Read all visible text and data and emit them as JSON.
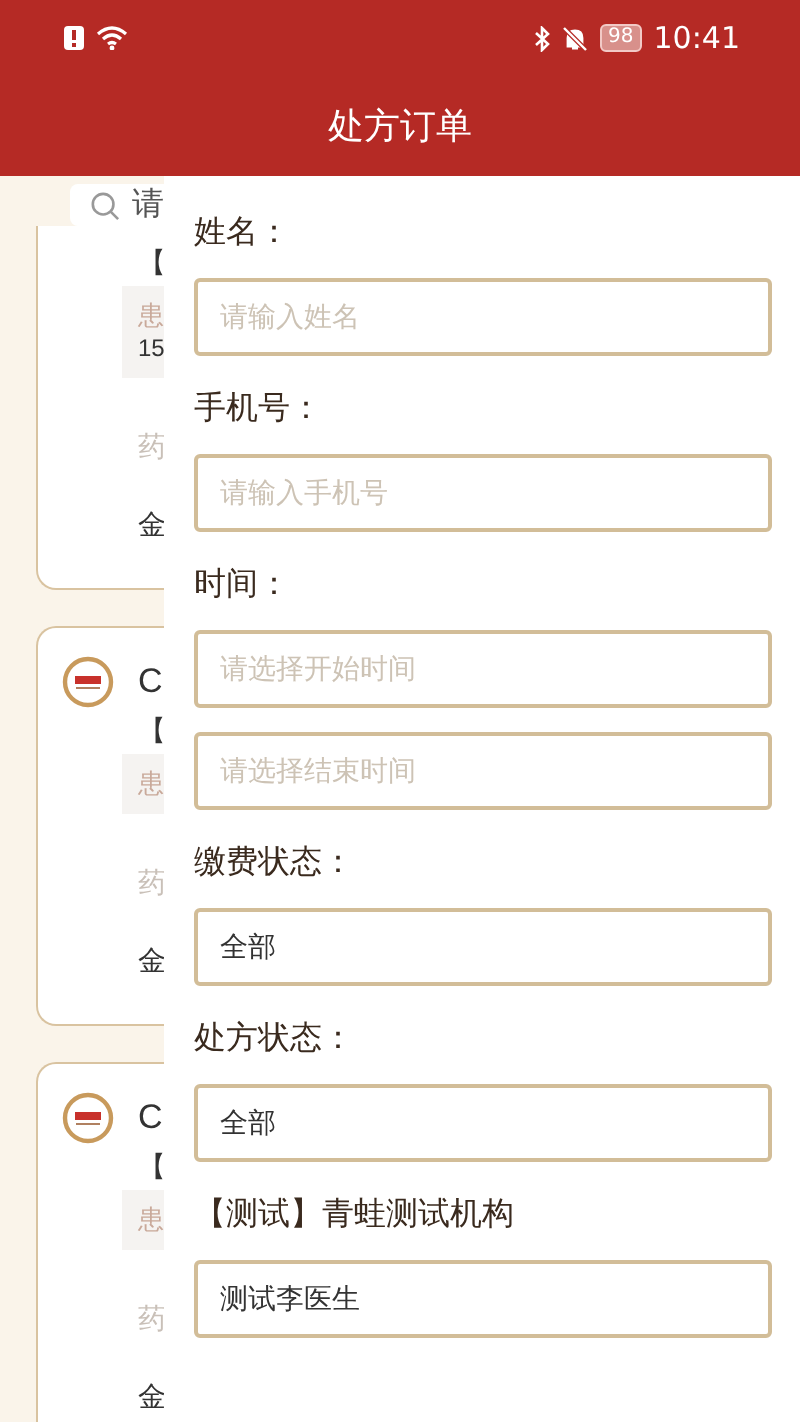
{
  "status_bar": {
    "battery": "98",
    "time": "10:41"
  },
  "header": {
    "title": "处方订单"
  },
  "background_list": {
    "search": {
      "placeholder": "请"
    },
    "cards": [
      {
        "logo": false,
        "tag": "【",
        "patient": "患",
        "phone": "15",
        "drug": "药",
        "amount": "金"
      },
      {
        "logo": true,
        "title": "C",
        "tag": "【",
        "patient": "患",
        "drug": "药",
        "amount": "金"
      },
      {
        "logo": true,
        "title": "C",
        "tag": "【",
        "patient": "患",
        "drug": "药",
        "amount": "金"
      }
    ]
  },
  "filter_drawer": {
    "fields": [
      {
        "kind": "label",
        "text": "姓名："
      },
      {
        "kind": "input",
        "placeholder": "请输入姓名"
      },
      {
        "kind": "label",
        "text": "手机号："
      },
      {
        "kind": "input",
        "placeholder": "请输入手机号"
      },
      {
        "kind": "label",
        "text": "时间："
      },
      {
        "kind": "input",
        "placeholder": "请选择开始时间"
      },
      {
        "kind": "input",
        "placeholder": "请选择结束时间"
      },
      {
        "kind": "label",
        "text": "缴费状态："
      },
      {
        "kind": "select",
        "value": "全部"
      },
      {
        "kind": "label",
        "text": "处方状态："
      },
      {
        "kind": "select",
        "value": "全部"
      },
      {
        "kind": "label",
        "text": "【测试】青蛙测试机构"
      },
      {
        "kind": "select",
        "value": "测试李医生"
      }
    ]
  }
}
